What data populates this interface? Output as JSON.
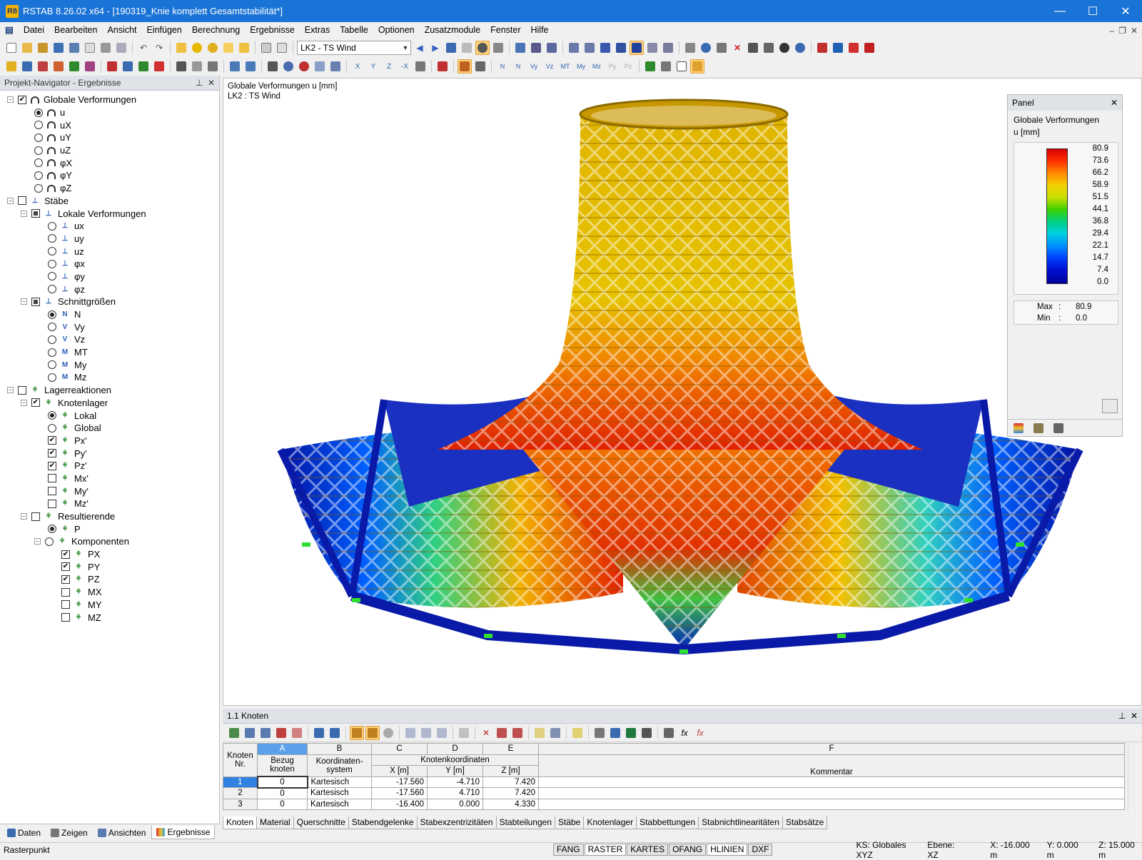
{
  "window": {
    "title": "RSTAB 8.26.02 x64 - [190319_Knie komplett Gesamtstabilität*]",
    "app_badge": "R8"
  },
  "menu": [
    "Datei",
    "Bearbeiten",
    "Ansicht",
    "Einfügen",
    "Berechnung",
    "Ergebnisse",
    "Extras",
    "Tabelle",
    "Optionen",
    "Zusatzmodule",
    "Fenster",
    "Hilfe"
  ],
  "toolbar": {
    "loadcase": "LK2 - TS Wind"
  },
  "navigator": {
    "title": "Projekt-Navigator - Ergebnisse",
    "items": [
      {
        "label": "Globale Verformungen"
      },
      {
        "label": "u"
      },
      {
        "label": "uX"
      },
      {
        "label": "uY"
      },
      {
        "label": "uZ"
      },
      {
        "label": "φX"
      },
      {
        "label": "φY"
      },
      {
        "label": "φZ"
      },
      {
        "label": "Stäbe"
      },
      {
        "label": "Lokale Verformungen"
      },
      {
        "label": "ux"
      },
      {
        "label": "uy"
      },
      {
        "label": "uz"
      },
      {
        "label": "φx"
      },
      {
        "label": "φy"
      },
      {
        "label": "φz"
      },
      {
        "label": "Schnittgrößen"
      },
      {
        "label": "N"
      },
      {
        "label": "Vy"
      },
      {
        "label": "Vz"
      },
      {
        "label": "MT"
      },
      {
        "label": "My"
      },
      {
        "label": "Mz"
      },
      {
        "label": "Lagerreaktionen"
      },
      {
        "label": "Knotenlager"
      },
      {
        "label": "Lokal"
      },
      {
        "label": "Global"
      },
      {
        "label": "Px'"
      },
      {
        "label": "Py'"
      },
      {
        "label": "Pz'"
      },
      {
        "label": "Mx'"
      },
      {
        "label": "My'"
      },
      {
        "label": "Mz'"
      },
      {
        "label": "Resultierende"
      },
      {
        "label": "P"
      },
      {
        "label": "Komponenten"
      },
      {
        "label": "PX"
      },
      {
        "label": "PY"
      },
      {
        "label": "PZ"
      },
      {
        "label": "MX"
      },
      {
        "label": "MY"
      },
      {
        "label": "MZ"
      }
    ],
    "tabs": [
      "Daten",
      "Zeigen",
      "Ansichten",
      "Ergebnisse"
    ]
  },
  "view": {
    "line1": "Globale Verformungen u [mm]",
    "line2": "LK2 : TS Wind"
  },
  "panel": {
    "title": "Panel",
    "heading": "Globale Verformungen",
    "unit": "u [mm]",
    "scale": [
      "80.9",
      "73.6",
      "66.2",
      "58.9",
      "51.5",
      "44.1",
      "36.8",
      "29.4",
      "22.1",
      "14.7",
      "7.4",
      "0.0"
    ],
    "max_label": "Max",
    "max_value": "80.9",
    "min_label": "Min",
    "min_value": "0.0"
  },
  "table": {
    "title": "1.1 Knoten",
    "col_letters": [
      "A",
      "B",
      "C",
      "D",
      "E",
      "F"
    ],
    "head_nr": [
      "Knoten",
      "Nr."
    ],
    "head_a": [
      "Bezug",
      "knoten"
    ],
    "head_b": [
      "Koordinaten-",
      "system"
    ],
    "head_group": "Knotenkoordinaten",
    "head_c": "X [m]",
    "head_d": "Y [m]",
    "head_e": "Z [m]",
    "head_f": "Kommentar",
    "rows": [
      {
        "nr": "1",
        "ref": "0",
        "sys": "Kartesisch",
        "x": "-17.560",
        "y": "-4.710",
        "z": "7.420"
      },
      {
        "nr": "2",
        "ref": "0",
        "sys": "Kartesisch",
        "x": "-17.560",
        "y": "4.710",
        "z": "7.420"
      },
      {
        "nr": "3",
        "ref": "0",
        "sys": "Kartesisch",
        "x": "-16.400",
        "y": "0.000",
        "z": "4.330"
      }
    ],
    "sheet_tabs": [
      "Knoten",
      "Material",
      "Querschnitte",
      "Stabendgelenke",
      "Stabexzentrizitäten",
      "Stabteilungen",
      "Stäbe",
      "Knotenlager",
      "Stabbettungen",
      "Stabnichtlinearitäten",
      "Stabsätze"
    ]
  },
  "status": {
    "left": "Rasterpunkt",
    "toggles": [
      "FANG",
      "RASTER",
      "KARTES",
      "OFANG",
      "HLINIEN",
      "DXF"
    ],
    "ks": "KS: Globales XYZ",
    "ebene": "Ebene: XZ",
    "x": "X:  -16.000 m",
    "y": "Y:  0.000 m",
    "z": "Z:  15.000 m"
  }
}
